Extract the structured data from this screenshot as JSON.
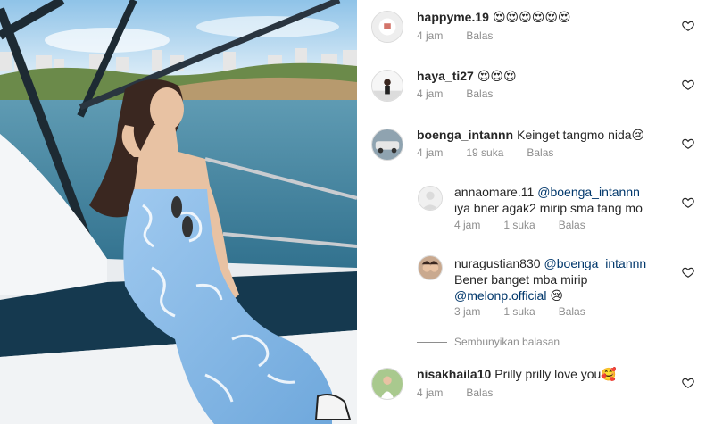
{
  "comments": [
    {
      "username": "happyme.19",
      "text": "😍😍😍😍😍😍",
      "time": "4 jam",
      "likes": "",
      "reply": "Balas"
    },
    {
      "username": "haya_ti27",
      "text": "😍😍😍",
      "time": "4 jam",
      "likes": "",
      "reply": "Balas"
    },
    {
      "username": "boenga_intannn",
      "text": "Keinget tangmo nida😢",
      "time": "4 jam",
      "likes": "19 suka",
      "reply": "Balas"
    },
    {
      "username": "annaomare.11",
      "mention": "@boenga_intannn",
      "text": "iya bner agak2 mirip sma tang mo",
      "time": "4 jam",
      "likes": "1 suka",
      "reply": "Balas"
    },
    {
      "username": "nuragustian830",
      "mention": "@boenga_intannn",
      "text": "Bener banget mba mirip",
      "mention2": "@melonp.official",
      "text2": "😢",
      "time": "3 jam",
      "likes": "1 suka",
      "reply": "Balas"
    },
    {
      "username": "nisakhaila10",
      "text": "Prilly prilly love you🥰",
      "time": "4 jam",
      "likes": "",
      "reply": "Balas"
    }
  ],
  "hide_replies": "Sembunyikan balasan",
  "icons": {
    "like": "heart-outline-icon"
  },
  "colors": {
    "mention": "#00376b",
    "meta": "#8e8e8e"
  }
}
